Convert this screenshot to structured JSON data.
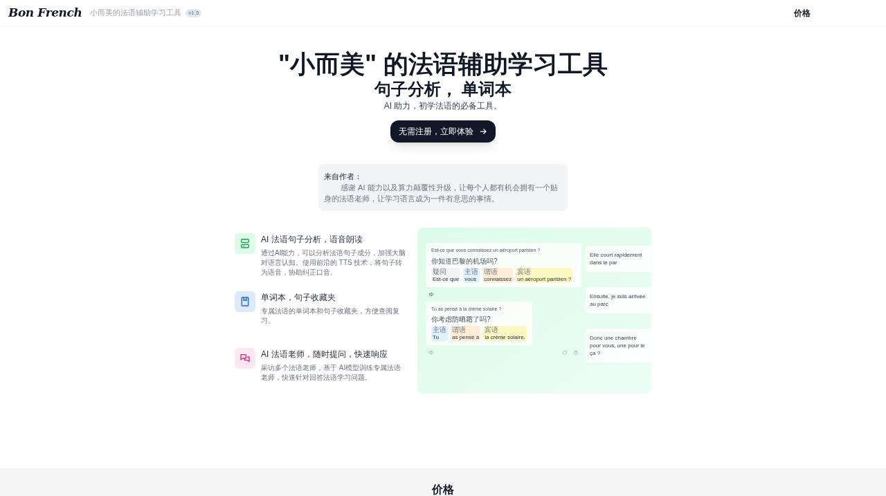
{
  "header": {
    "logo": "Bon French",
    "tagline": "小而美的法语辅助学习工具",
    "version": "v1.5",
    "nav": [
      {
        "label": "价格"
      }
    ]
  },
  "hero": {
    "title": "\"小而美\" 的法语辅助学习工具",
    "subtitle": "句子分析， 单词本",
    "description": "AI 助力，初学法语的必备工具。",
    "cta": "无需注册，立即体验"
  },
  "quote": {
    "heading": "来自作者：",
    "body": "感谢 AI 能力以及算力颠覆性升级，让每个人都有机会拥有一个贴身的法语老师，让学习语言成为一件有意思的事情。"
  },
  "features": [
    {
      "kind": "analysis",
      "color": "#dcfce7",
      "title": "AI 法语句子分析，语音朗读",
      "body": "通过AI能力，可以分析法语句子成分，加强大脑对语言认知。使用前沿的 TTS 技术，将句子转为语音，协助纠正口音。"
    },
    {
      "kind": "book",
      "color": "#dbeafe",
      "title": "单词本，句子收藏夹",
      "body": "专属法语的单词本和句子收藏夹，方便查阅复习。"
    },
    {
      "kind": "chat",
      "color": "#fce7f3",
      "title": "AI 法语老师，随时提问，快速响应",
      "body": "采访多个法语老师，基于 AI模型训练专属法语老师，快速针对回答法语学习问题。"
    }
  ],
  "preview": {
    "cards": [
      {
        "sentence": "Est-ce que vous connaissez un aéroport parisien ?",
        "translation": "你知道巴黎的机场吗?",
        "chunks": [
          {
            "role": "疑问",
            "text": "Est-ce que",
            "color": "#f3f4f6"
          },
          {
            "role": "主语",
            "text": "vous",
            "color": "#e0f2fe"
          },
          {
            "role": "谓语",
            "text": "connaissez",
            "color": "#ffedd5"
          },
          {
            "role": "宾语",
            "text": "un aéroport parisien ?",
            "color": "#fef9c3"
          }
        ]
      },
      {
        "sentence": "Tu as pensé à la crème solaire ?",
        "translation": "你考虑防晒霜了吗?",
        "chunks": [
          {
            "role": "主语",
            "text": "Tu",
            "color": "#e0f2fe"
          },
          {
            "role": "谓语",
            "text": "as pensé à",
            "color": "#ffedd5"
          },
          {
            "role": "宾语",
            "text": "la crème solaire.",
            "color": "#fef9c3"
          }
        ]
      }
    ],
    "side_cards": [
      {
        "sentence": "Elle court rapidement dans le par"
      },
      {
        "sentence": "Ensuite, je suis arrivée au parc"
      },
      {
        "sentence": "Donc une chambre pour vous, une pour le ça ?"
      }
    ]
  },
  "pricing": {
    "title": "价格"
  }
}
